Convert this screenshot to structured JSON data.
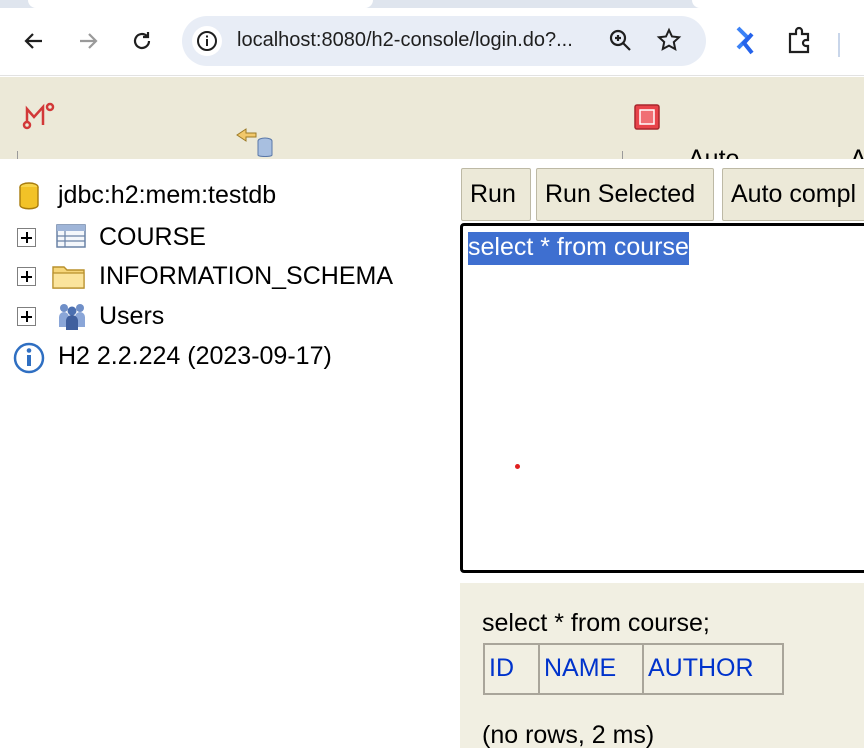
{
  "browser": {
    "url": "localhost:8080/h2-console/login.do?...",
    "accent": "#1a73e8"
  },
  "h2_toolbar": {
    "cut_label_1": "Auto",
    "cut_label_2": "A",
    "icons": [
      "disconnect-icon",
      "refresh-icon",
      "stop-icon"
    ]
  },
  "tree": {
    "connection": "jdbc:h2:mem:testdb",
    "items": [
      {
        "label": "COURSE",
        "icon": "table-icon"
      },
      {
        "label": "INFORMATION_SCHEMA",
        "icon": "folder-icon"
      },
      {
        "label": "Users",
        "icon": "users-icon"
      }
    ],
    "version": "H2 2.2.224 (2023-09-17)"
  },
  "query": {
    "buttons": {
      "run": "Run",
      "run_selected": "Run Selected",
      "auto_complete": "Auto compl"
    },
    "sql": "select * from course",
    "selection_color": "#3e6fd0"
  },
  "result": {
    "statement": "select * from course;",
    "columns": [
      "ID",
      "NAME",
      "AUTHOR"
    ],
    "info": "(no rows, 2 ms)",
    "header_color": "#0033cc"
  }
}
